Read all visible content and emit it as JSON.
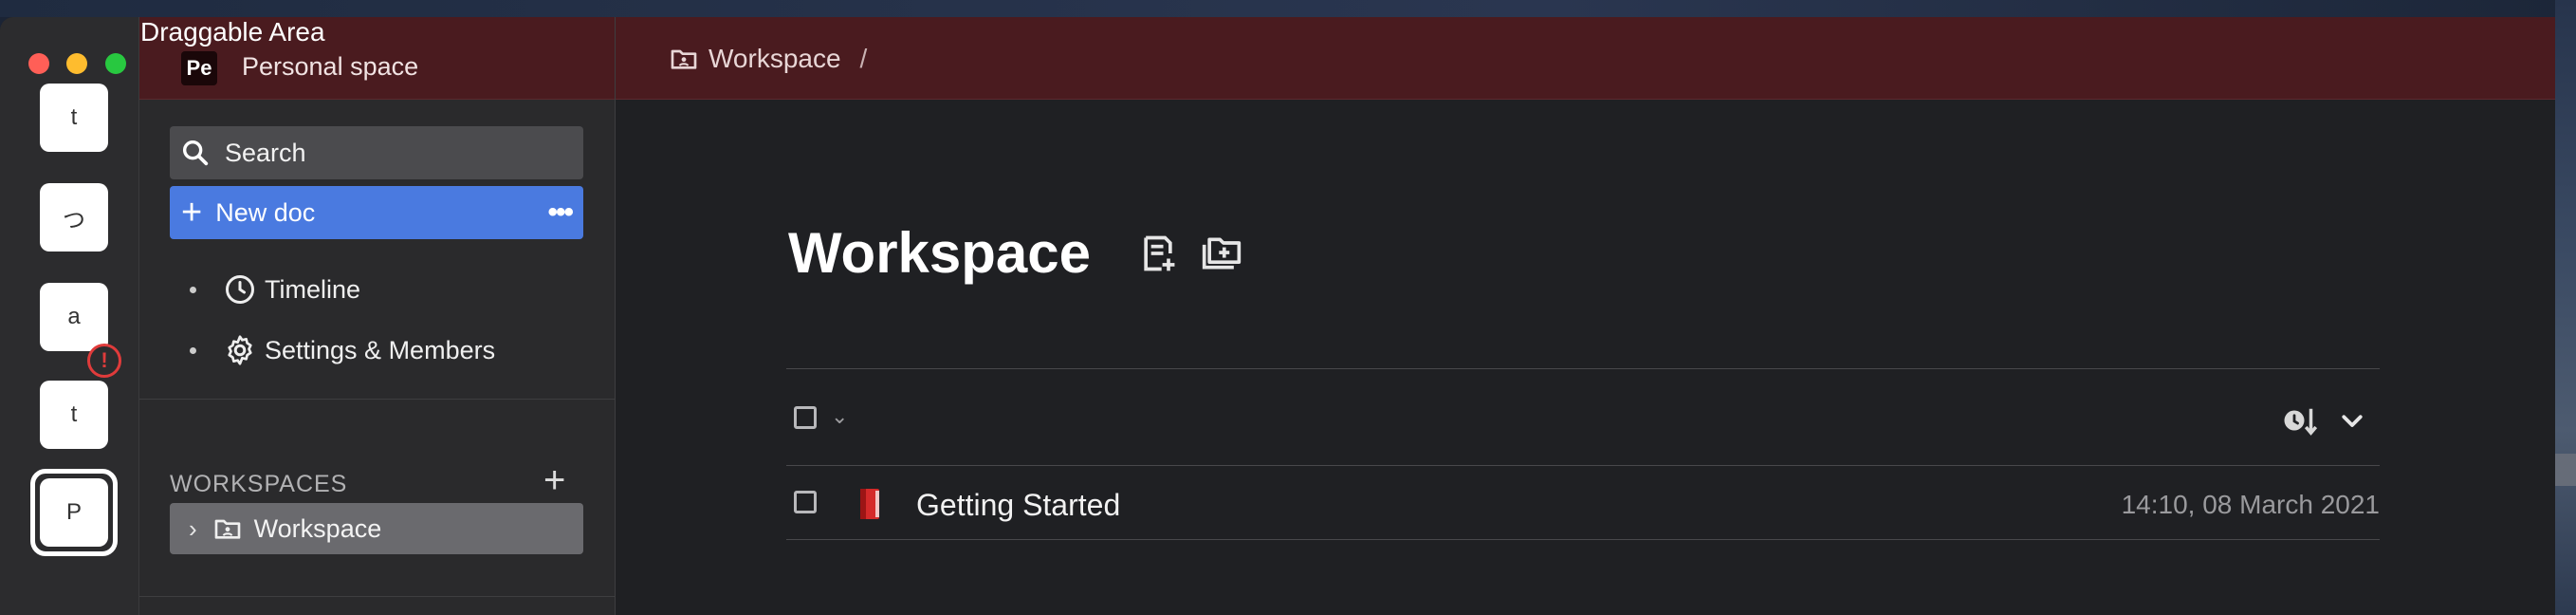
{
  "window": {
    "drag_area_label": "Draggable Area"
  },
  "rail": {
    "tiles": [
      "t",
      "つ",
      "a",
      "t",
      "P"
    ],
    "error_badge": "!"
  },
  "sidebar": {
    "space_avatar": "Pe",
    "space_name": "Personal space",
    "search_label": "Search",
    "new_doc_label": "New doc",
    "new_doc_more": "•••",
    "nav": [
      {
        "label": "Timeline",
        "icon": "clock-icon"
      },
      {
        "label": "Settings & Members",
        "icon": "gear-icon"
      }
    ],
    "workspaces_title": "WORKSPACES",
    "workspaces_add": "+",
    "workspace_items": [
      {
        "label": "Workspace",
        "icon": "folder-person-icon"
      }
    ]
  },
  "main": {
    "breadcrumb": {
      "label": "Workspace",
      "separator": "/"
    },
    "title": "Workspace",
    "docs": [
      {
        "title": "Getting Started",
        "date": "14:10, 08 March 2021",
        "icon": "red-book-icon"
      }
    ]
  },
  "colors": {
    "header_bg": "#4a1b1f",
    "accent": "#4a7ae0",
    "error": "#e03b3b"
  }
}
